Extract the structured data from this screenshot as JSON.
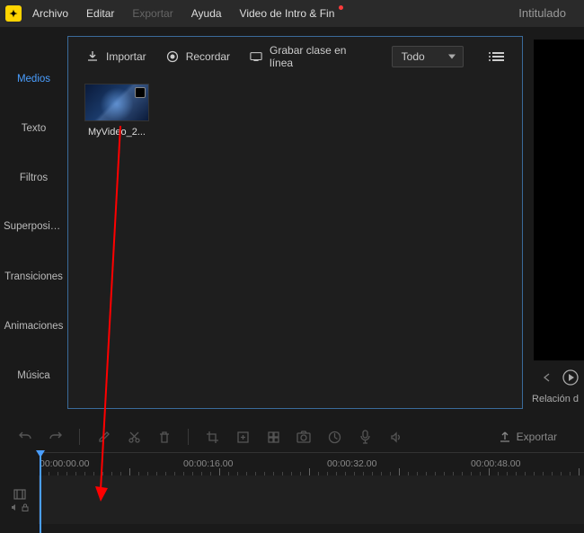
{
  "title": "Intitulado",
  "menu": {
    "archivo": "Archivo",
    "editar": "Editar",
    "exportar": "Exportar",
    "ayuda": "Ayuda",
    "intro": "Video de Intro & Fin"
  },
  "sidebar": {
    "medios": "Medios",
    "texto": "Texto",
    "filtros": "Filtros",
    "superposicion": "Superposicio...",
    "transiciones": "Transiciones",
    "animaciones": "Animaciones",
    "musica": "Música"
  },
  "toolbar": {
    "importar": "Importar",
    "recordar": "Recordar",
    "grabar": "Grabar clase en línea",
    "filtro": "Todo"
  },
  "clip": {
    "name": "MyVideo_2..."
  },
  "preview": {
    "ratio": "Relación d"
  },
  "toolbar2": {
    "export": "Exportar"
  },
  "timeline": {
    "t0": "00:00:00.00",
    "t1": "00:00:16.00",
    "t2": "00:00:32.00",
    "t3": "00:00:48.00"
  }
}
